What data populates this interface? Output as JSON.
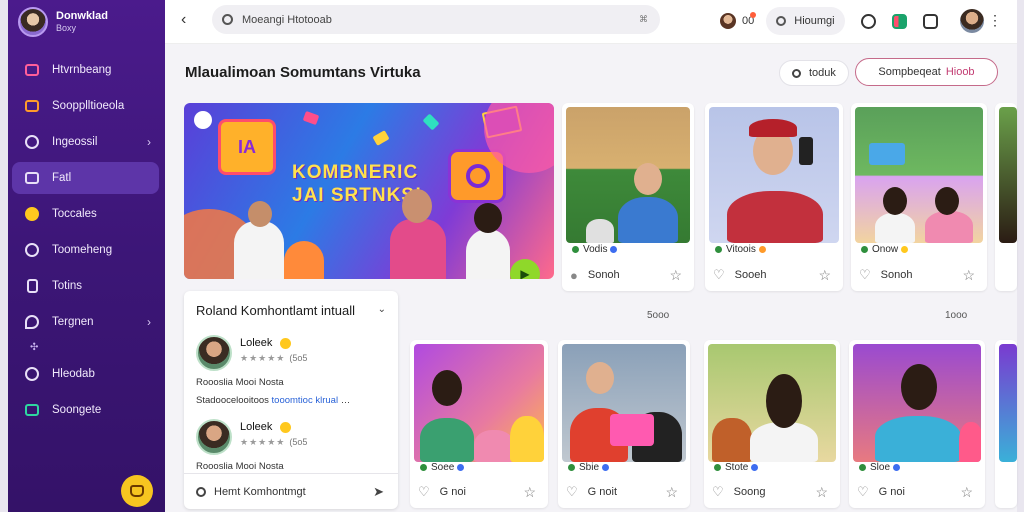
{
  "sidebar": {
    "brand_title": "Donwklad",
    "brand_sub": "Boxy",
    "items": [
      {
        "label": "Htvrnbeang",
        "icon": "tv-icon",
        "color": "#ff5f9a"
      },
      {
        "label": "Soopplltioeola",
        "icon": "inbox-icon",
        "color": "#ff9a2a"
      },
      {
        "label": "Ingeossil",
        "icon": "globe-icon",
        "color": "#e8e0f7",
        "chevron": "›"
      },
      {
        "label": "Fatl",
        "icon": "calendar-icon",
        "color": "#e8e0f7",
        "active": true
      },
      {
        "label": "Toccales",
        "icon": "smile-icon",
        "color": "#ffc81e"
      },
      {
        "label": "Toomeheng",
        "icon": "info-icon",
        "color": "#e8e0f7"
      },
      {
        "label": "Totins",
        "icon": "file-icon",
        "color": "#e8e0f7"
      },
      {
        "label": "Tergnen",
        "icon": "location-icon",
        "color": "#e8e0f7",
        "chevron": "›"
      },
      {
        "label": "Hleodab",
        "icon": "heart-icon",
        "color": "#e8e0f7"
      },
      {
        "label": "Soongete",
        "icon": "panel-icon",
        "color": "#2fd6a0"
      }
    ]
  },
  "topbar": {
    "back": "‹",
    "search_placeholder": "Moeangi Htotooab",
    "search_kbd": "⌘",
    "glyph_a": "00",
    "search_pill": "Hioumgi",
    "more": "⋮⋮"
  },
  "main": {
    "title": "Mlaualimoan Somumtans Virtuka",
    "filter_label": "toduk",
    "compose_label": "Sompbeqeat",
    "compose_accent": "Hioob",
    "hero": {
      "logo_text": "IA",
      "headline": "KOMBNERIC JAI SRTNKS!"
    },
    "count_a": "5ooo",
    "count_b": "1ooo",
    "cards_top": [
      {
        "caption": "Vodis",
        "footer": "Sonoh"
      },
      {
        "caption": "Vitoois",
        "footer": "Sooeh"
      },
      {
        "caption": "Onow",
        "footer": "Sonoh"
      }
    ],
    "cards_bottom": [
      {
        "caption": "Soee",
        "footer": "G noi"
      },
      {
        "caption": "Sbie",
        "footer": "G noit"
      },
      {
        "caption": "Stote",
        "footer": "Soong"
      },
      {
        "caption": "Sloe",
        "footer": "G noi"
      }
    ]
  },
  "reviews": {
    "title": "Roland Komhontlamt intuall",
    "chevron": "⌄",
    "items": [
      {
        "name": "Loleek",
        "stars": "★★★★★",
        "count": "(5o5",
        "line1": "Roooslia Mooi Nosta",
        "line2_a": "Stadoocelooitoos ",
        "line2_link": "tooomtioc klrual",
        "line2_tail": " …"
      },
      {
        "name": "Loleek",
        "stars": "★★★★★",
        "count": "(5o5",
        "line1": "Roooslia Mooi Nosta"
      }
    ],
    "input_placeholder": "Hemt Komhontmgt"
  }
}
